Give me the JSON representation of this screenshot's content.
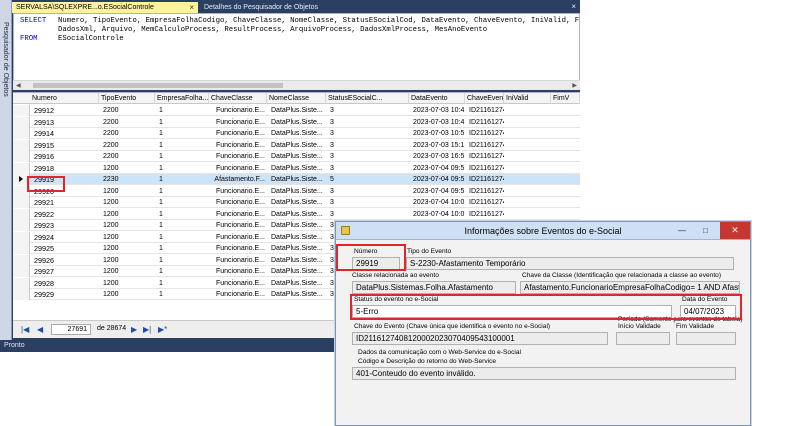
{
  "ssms": {
    "side_label": "Pesquisador de Objetos",
    "tab_active": "SERVALSA\\SQLEXPRE...o.ESocialControle",
    "tab_close": "×",
    "tab_inactive": "Detalhes do Pesquisador de Objetos",
    "tabs_close": "×",
    "sql": {
      "line1_kw": "SELECT",
      "line1": "Numero, TipoEvento, EmpresaFolhaCodigo, ChaveClasse, NomeClasse, StatusESocialCod, DataEvento, ChaveEvento, IniValid, FimValid, RetornoCod, RetornoDescr, Protocolo, d",
      "line2": "DadosXml, Arquivo, MemCalculoProcess, ResultProcess, ArquivoProcess, DadosXmlProcess, MesAnoEvento",
      "line3_kw": "FROM",
      "line3": "ESocialControle"
    },
    "grid": {
      "columns": [
        "Numero",
        "TipoEvento",
        "EmpresaFolha...",
        "ChaveClasse",
        "NomeClasse",
        "StatusESocialC...",
        "DataEvento",
        "ChaveEvento",
        "IniValid",
        "FimV"
      ],
      "rows": [
        [
          "29912",
          "2200",
          "1",
          "Funcionario.E...",
          "DataPlus.Siste...",
          "3",
          "2023-07-03 10:4...",
          "ID21161274081..."
        ],
        [
          "29913",
          "2200",
          "1",
          "Funcionario.E...",
          "DataPlus.Siste...",
          "3",
          "2023-07-03 10:4...",
          "ID21161274081..."
        ],
        [
          "29914",
          "2200",
          "1",
          "Funcionario.E...",
          "DataPlus.Siste...",
          "3",
          "2023-07-03 10:5...",
          "ID21161274081..."
        ],
        [
          "29915",
          "2200",
          "1",
          "Funcionario.E...",
          "DataPlus.Siste...",
          "3",
          "2023-07-03 15:1...",
          "ID21161274081..."
        ],
        [
          "29916",
          "2200",
          "1",
          "Funcionario.E...",
          "DataPlus.Siste...",
          "3",
          "2023-07-03 16:5...",
          "ID21161274081..."
        ],
        [
          "29918",
          "1200",
          "1",
          "Funcionario.E...",
          "DataPlus.Siste...",
          "3",
          "2023-07-04 09:5...",
          "ID21161274081..."
        ],
        [
          "29919",
          "2230",
          "1",
          "Afastamento.F...",
          "DataPlus.Siste...",
          "5",
          "2023-07-04 09:5...",
          "ID21161274081..."
        ],
        [
          "29920",
          "1200",
          "1",
          "Funcionario.E...",
          "DataPlus.Siste...",
          "3",
          "2023-07-04 09:5...",
          "ID21161274081..."
        ],
        [
          "29921",
          "1200",
          "1",
          "Funcionario.E...",
          "DataPlus.Siste...",
          "3",
          "2023-07-04 10:0...",
          "ID21161274081..."
        ],
        [
          "29922",
          "1200",
          "1",
          "Funcionario.E...",
          "DataPlus.Siste...",
          "3",
          "2023-07-04 10:0...",
          "ID21161274081..."
        ],
        [
          "29923",
          "1200",
          "1",
          "Funcionario.E...",
          "DataPlus.Siste...",
          "3",
          "2023-07-04 10:0...",
          "ID21161274081..."
        ],
        [
          "29924",
          "1200",
          "1",
          "Funcionario.E...",
          "DataPlus.Siste...",
          "3",
          "2023-07-04 10:0...",
          "ID21161274081..."
        ],
        [
          "29925",
          "1200",
          "1",
          "Funcionario.E...",
          "DataPlus.Siste...",
          "3",
          "",
          ""
        ],
        [
          "29926",
          "1200",
          "1",
          "Funcionario.E...",
          "DataPlus.Siste...",
          "3",
          "",
          ""
        ],
        [
          "29927",
          "1200",
          "1",
          "Funcionario.E...",
          "DataPlus.Siste...",
          "3",
          "",
          ""
        ],
        [
          "29928",
          "1200",
          "1",
          "Funcionario.E...",
          "DataPlus.Siste...",
          "3",
          "",
          ""
        ],
        [
          "29929",
          "1200",
          "1",
          "Funcionario.E...",
          "DataPlus.Siste...",
          "3",
          "",
          ""
        ]
      ]
    },
    "nav": {
      "first": "|◀",
      "prev": "◀",
      "current": "27691",
      "of": "de 28674",
      "next": "▶",
      "last": "▶|",
      "new": "▶*"
    },
    "status": "Pronto"
  },
  "dialog": {
    "title": "Informações sobre Eventos do e-Social",
    "minimize": "—",
    "maximize": "□",
    "close": "✕",
    "numero_label": "Número",
    "numero": "29919",
    "tipo_label": "Tipo do Evento",
    "tipo": "S-2230-Afastamento Temporário",
    "classe_label": "Classe relacionada ao evento",
    "classe": "DataPlus.Sistemas.Folha.Afastamento",
    "chave_classe_label": "Chave da Classe (Identificação que relacionada a classe ao evento)",
    "chave_classe": "Afastamento.FuncionarioEmpresaFolhaCodigo= 1  AND Afastam",
    "status_label": "Status do evento no e-Social",
    "status": "5-Erro",
    "data_label": "Data do Evento",
    "data": "04/07/2023",
    "chave_evento_label": "Chave do Evento (Chave única que identifica o evento no e-Social)",
    "chave_evento": "ID2116127408120002023070409543100001",
    "periodo_label": "Período (Somente para eventos de tabela)",
    "inicio_label": "Início Validade",
    "fim_label": "Fim Validade",
    "comunicacao_label": "Dados da comunicação com o Web-Service do e-Social",
    "retorno_label": "Código e Descrição do retorno do Web-Service",
    "retorno": "401-Conteudo do evento inválido."
  }
}
